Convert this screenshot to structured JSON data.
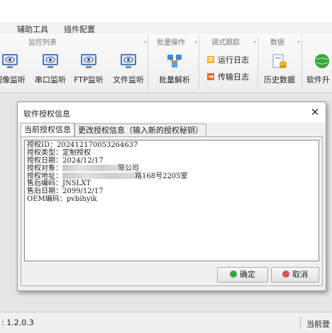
{
  "menubar": {
    "items": [
      "辅助工具",
      "插件配置"
    ]
  },
  "ribbon": {
    "groups": {
      "monitor": "监控列表",
      "batch": "批量操作",
      "debug": "调式跟踪",
      "data": "数据"
    },
    "buttons": {
      "image_monitor": "图像监听",
      "serial_monitor": "串口监听",
      "ftp_monitor": "FTP监听",
      "file_monitor": "文件监听",
      "batch_parse": "批量解析",
      "run_log": "运行日志",
      "transfer_log": "传输日志",
      "history_data": "历史数据",
      "software_upgrade": "软件升"
    }
  },
  "statusbar": {
    "version": ": 1.2.0.3",
    "right_text": "当前登"
  },
  "dialog": {
    "title": "软件授权信息",
    "close_glyph": "✕",
    "tabs": [
      "当前授权信息",
      "更改授权信息（输入新的授权秘钥）"
    ],
    "info": {
      "auth_id": "授权ID：202412170053264637",
      "auth_type": "授权类型：定制授权",
      "auth_date": "授权日期：2024/12/17",
      "auth_target_prefix": "授权对象：",
      "auth_target_suffix": "限公司",
      "auth_address_prefix": "授权地址：",
      "auth_address_suffix": "路168号2205室",
      "sales_code": "售后编码：JNSLXT",
      "sales_date": "售后日期：2099/12/17",
      "oem_code": "OEM编码：pvbihyik"
    },
    "ok_label": "确定",
    "cancel_label": "取消"
  },
  "colors": {
    "ok_icon": "#3aa53a",
    "cancel_icon": "#d9534f",
    "accent": "#2a7ad4"
  }
}
